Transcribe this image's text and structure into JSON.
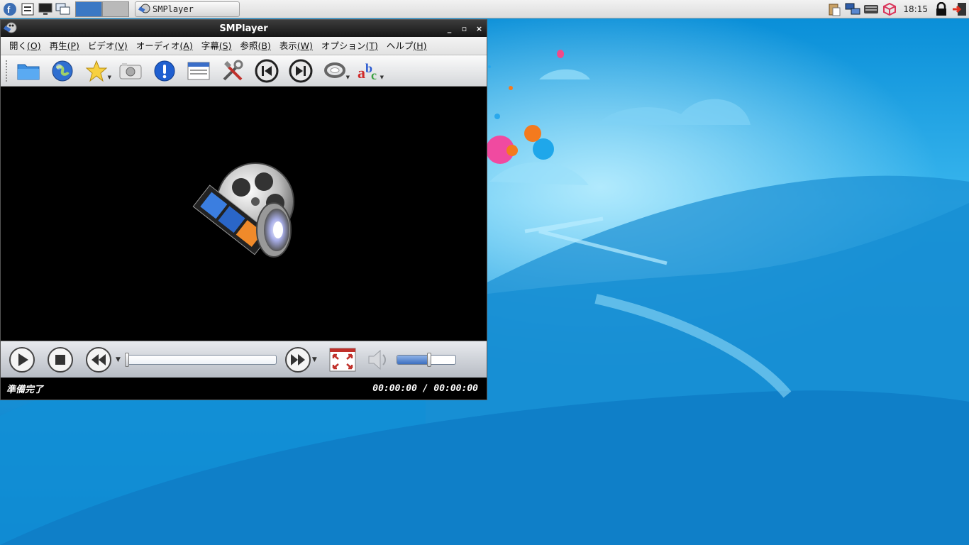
{
  "panel": {
    "task_title": "SMPlayer",
    "clock": "18:15",
    "icons": [
      "fedora-logo-icon",
      "file-manager-icon",
      "monitor-icon",
      "windows-icon",
      "clipboard-icon",
      "network-icon",
      "keyboard-icon",
      "package-icon",
      "lock-icon",
      "logout-icon"
    ]
  },
  "window": {
    "title": "SMPlayer",
    "controls": {
      "minimize": "_",
      "maximize": "▫",
      "close": "×"
    }
  },
  "menu": [
    {
      "label": "開く",
      "key": "(O)"
    },
    {
      "label": "再生",
      "key": "(P)"
    },
    {
      "label": "ビデオ",
      "key": "(V)"
    },
    {
      "label": "オーディオ",
      "key": "(A)"
    },
    {
      "label": "字幕",
      "key": "(S)"
    },
    {
      "label": "参照",
      "key": "(B)"
    },
    {
      "label": "表示",
      "key": "(W)"
    },
    {
      "label": "オプション",
      "key": "(T)"
    },
    {
      "label": "ヘルプ",
      "key": "(H)"
    }
  ],
  "status": {
    "message": "準備完了",
    "time": "00:00:00 / 00:00:00"
  },
  "playback": {
    "position_fraction": 0.0,
    "volume_fraction": 0.55
  },
  "colors": {
    "desktop": "#0b8fd6",
    "workspace_active": "#3b78c4",
    "titlebar": "#161616"
  }
}
